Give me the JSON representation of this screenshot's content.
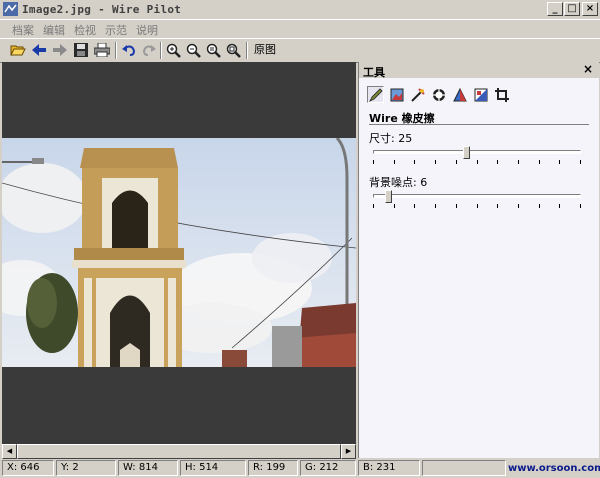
{
  "window": {
    "title": "Image2.jpg - Wire Pilot",
    "minimize": "_",
    "maximize": "□",
    "close": "×"
  },
  "menu": [
    "档案",
    "编辑",
    "检视",
    "示范",
    "说明"
  ],
  "toolbar": {
    "buttons": [
      "open-icon",
      "back-icon",
      "forward-icon",
      "save-icon",
      "print-icon",
      "undo-icon",
      "redo-icon",
      "zoom-in-icon",
      "zoom-out-icon",
      "zoom-fit-icon",
      "zoom-actual-icon"
    ],
    "original_label": "原图"
  },
  "panel": {
    "title": "工具",
    "close": "×",
    "tools": [
      "pencil-icon",
      "image-icon",
      "wand-icon",
      "target-icon",
      "triangle-icon",
      "mask-icon",
      "crop-icon"
    ],
    "tool_name": "Wire 橡皮擦",
    "size": {
      "label": "尺寸:",
      "value": "25",
      "fraction": 0.45
    },
    "noise": {
      "label": "背景噪点:",
      "value": "6",
      "fraction": 0.06
    }
  },
  "status": {
    "x_label": "X:",
    "x": "646",
    "y_label": "Y:",
    "y": "2",
    "w_label": "W:",
    "w": "814",
    "h_label": "H:",
    "h": "514",
    "r_label": "R:",
    "r": "199",
    "g_label": "G:",
    "g": "212",
    "b_label": "B:",
    "b": "231",
    "brand": "www.orsoon.com"
  }
}
